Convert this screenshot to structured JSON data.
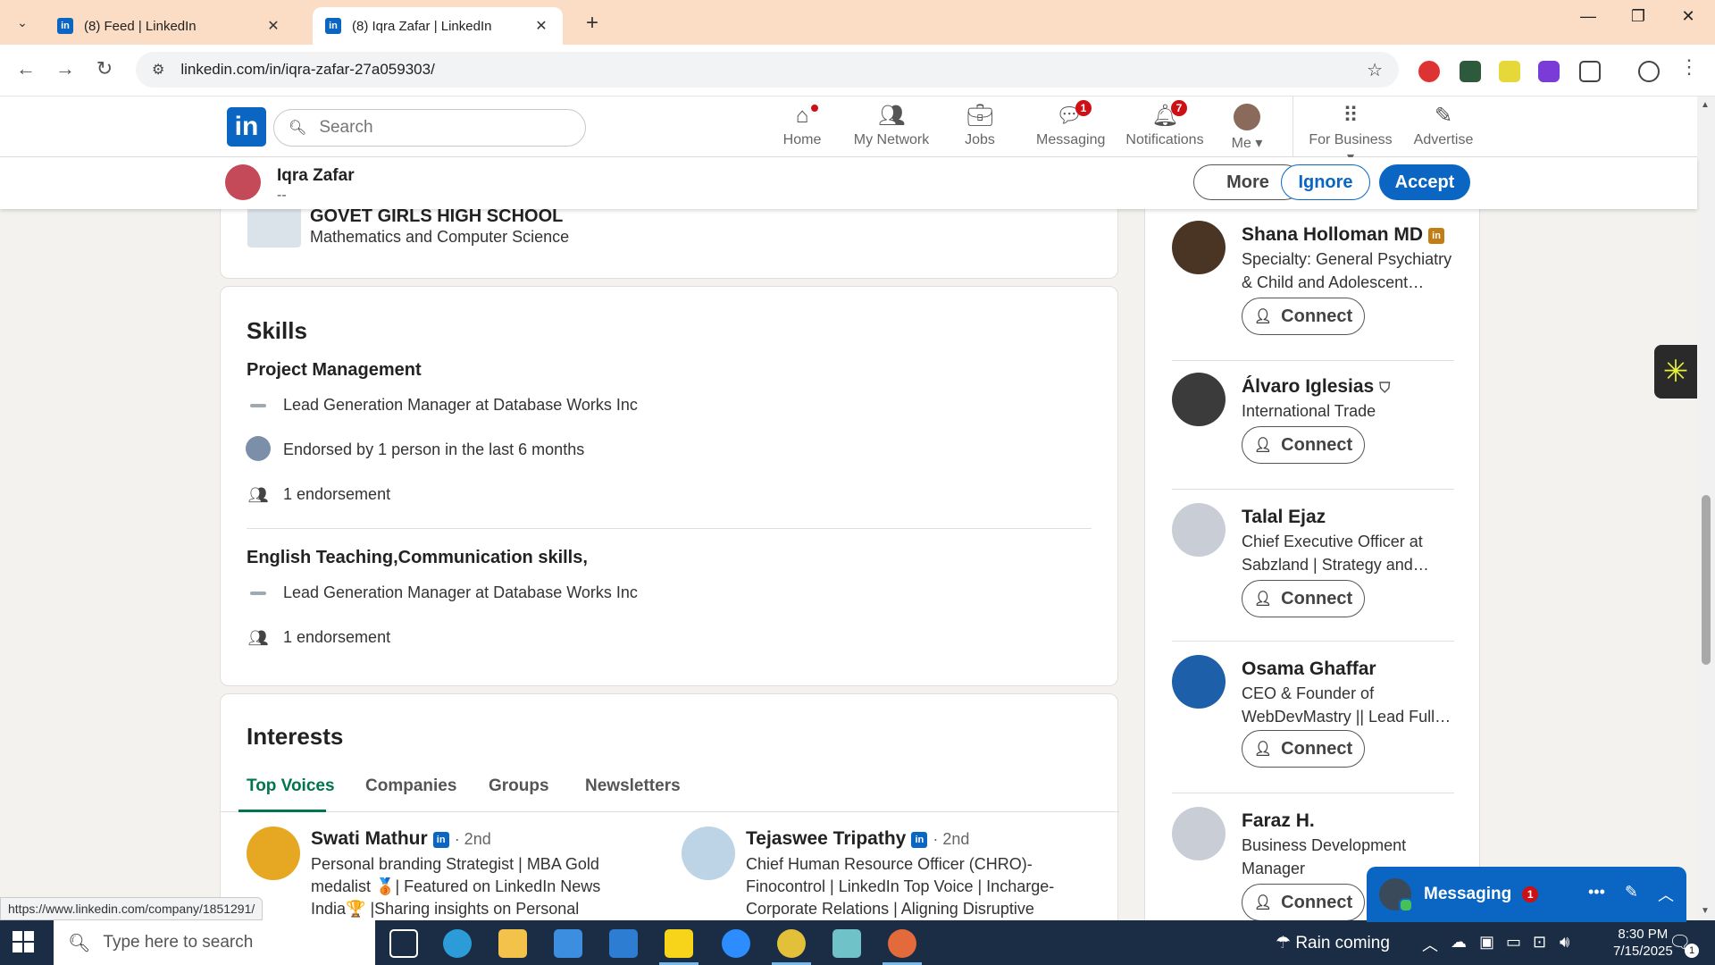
{
  "browser": {
    "tabs": [
      {
        "title": "(8) Feed | LinkedIn",
        "active": false
      },
      {
        "title": "(8) Iqra Zafar | LinkedIn",
        "active": true
      }
    ],
    "url": "linkedin.com/in/iqra-zafar-27a059303/",
    "status_url": "https://www.linkedin.com/company/1851291/"
  },
  "header": {
    "logo": "in",
    "search_placeholder": "Search",
    "nav": [
      {
        "label": "Home",
        "icon": "home-icon",
        "badge": ""
      },
      {
        "label": "My Network",
        "icon": "network-icon",
        "badge": ""
      },
      {
        "label": "Jobs",
        "icon": "briefcase-icon",
        "badge": ""
      },
      {
        "label": "Messaging",
        "icon": "chat-icon",
        "badge": "1"
      },
      {
        "label": "Notifications",
        "icon": "bell-icon",
        "badge": "7"
      },
      {
        "label": "Me",
        "icon": "avatar",
        "badge": ""
      },
      {
        "label": "For Business",
        "icon": "grid-icon",
        "badge": ""
      },
      {
        "label": "Advertise",
        "icon": "advertise-icon",
        "badge": ""
      }
    ]
  },
  "sticky": {
    "name": "Iqra Zafar",
    "subtitle": "--",
    "more": "More",
    "ignore": "Ignore",
    "accept": "Accept"
  },
  "education": {
    "school": "GOVET GIRLS HIGH SCHOOL",
    "field": "Mathematics and Computer Science"
  },
  "skills": {
    "title": "Skills",
    "items": [
      {
        "name": "Project Management",
        "company_line": "Lead Generation Manager at Database Works Inc",
        "endorsed_by": "Endorsed by 1 person in the last 6 months",
        "endorsements": "1 endorsement"
      },
      {
        "name": "English Teaching,Communication skills,",
        "company_line": "Lead Generation Manager at Database Works Inc",
        "endorsements": "1 endorsement"
      }
    ]
  },
  "interests": {
    "title": "Interests",
    "tabs": [
      "Top Voices",
      "Companies",
      "Groups",
      "Newsletters"
    ],
    "active_tab": "Top Voices",
    "voices": [
      {
        "name": "Swati Mathur",
        "degree": "· 2nd",
        "desc": "Personal branding Strategist | MBA Gold medalist 🥉| Featured on LinkedIn News India🏆 |Sharing insights on Personal development, Content creation & Personal branding"
      },
      {
        "name": "Tejaswee Tripathy",
        "degree": "· 2nd",
        "desc": "Chief Human Resource Officer (CHRO)-Finocontrol | LinkedIn Top Voice | Incharge-Corporate Relations | Aligning Disruptive Talent with Organisation | Content Strategist | Helping"
      }
    ]
  },
  "suggestions": {
    "connect_label": "Connect",
    "people": [
      {
        "name": "Shana Holloman MD",
        "desc": "Specialty: General Psychiatry & Child and Adolescent…",
        "badge": "in"
      },
      {
        "name": "Álvaro Iglesias",
        "desc": "International Trade",
        "badge": "verified"
      },
      {
        "name": "Talal Ejaz",
        "desc": "Chief Executive Officer at Sabzland | Strategy and…",
        "badge": ""
      },
      {
        "name": "Osama Ghaffar",
        "desc": "CEO & Founder of WebDevMastry || Lead Full…",
        "badge": ""
      },
      {
        "name": "Faraz H.",
        "desc": "Business Development Manager",
        "badge": ""
      }
    ]
  },
  "messaging": {
    "label": "Messaging",
    "badge": "1"
  },
  "taskbar": {
    "search_placeholder": "Type here to search",
    "weather": "Rain coming",
    "time": "8:30 PM",
    "date": "7/15/2025",
    "notif_count": "1"
  },
  "colors": {
    "linkedin_blue": "#0a66c2",
    "accent_green": "#01754f",
    "badge_red": "#cc1016",
    "tabbar": "#fbdcc4"
  }
}
